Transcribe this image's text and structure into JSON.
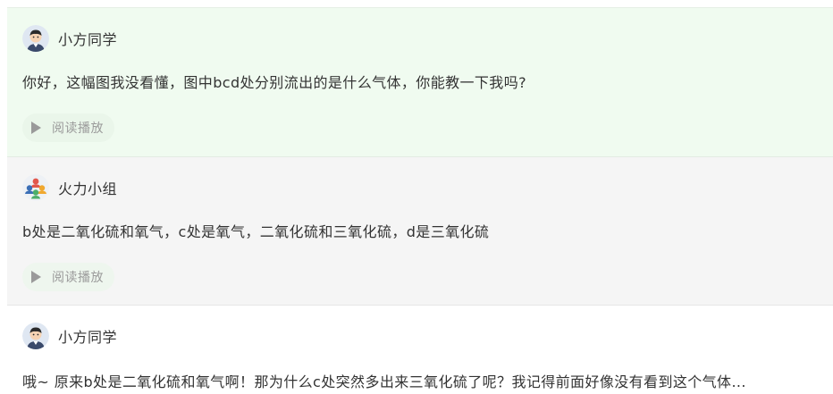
{
  "messages": [
    {
      "author": "小方同学",
      "avatar_icon": "student-avatar-icon",
      "text": "你好，这幅图我没看懂，图中bcd处分别流出的是什么气体，你能教一下我吗?",
      "read_label": "阅读播放"
    },
    {
      "author": "火力小组",
      "avatar_icon": "group-avatar-icon",
      "text": "b处是二氧化硫和氧气，c处是氧气，二氧化硫和三氧化硫，d是三氧化硫",
      "read_label": "阅读播放"
    },
    {
      "author": "小方同学",
      "avatar_icon": "student-avatar-icon",
      "text": "哦~ 原来b处是二氧化硫和氧气啊！那为什么c处突然多出来三氧化硫了呢？我记得前面好像没有看到这个气体..."
    }
  ],
  "colors": {
    "student_bg": "#f0fbf0",
    "group_bg": "#f5f5f5",
    "muted_text": "#9a9a9a"
  }
}
